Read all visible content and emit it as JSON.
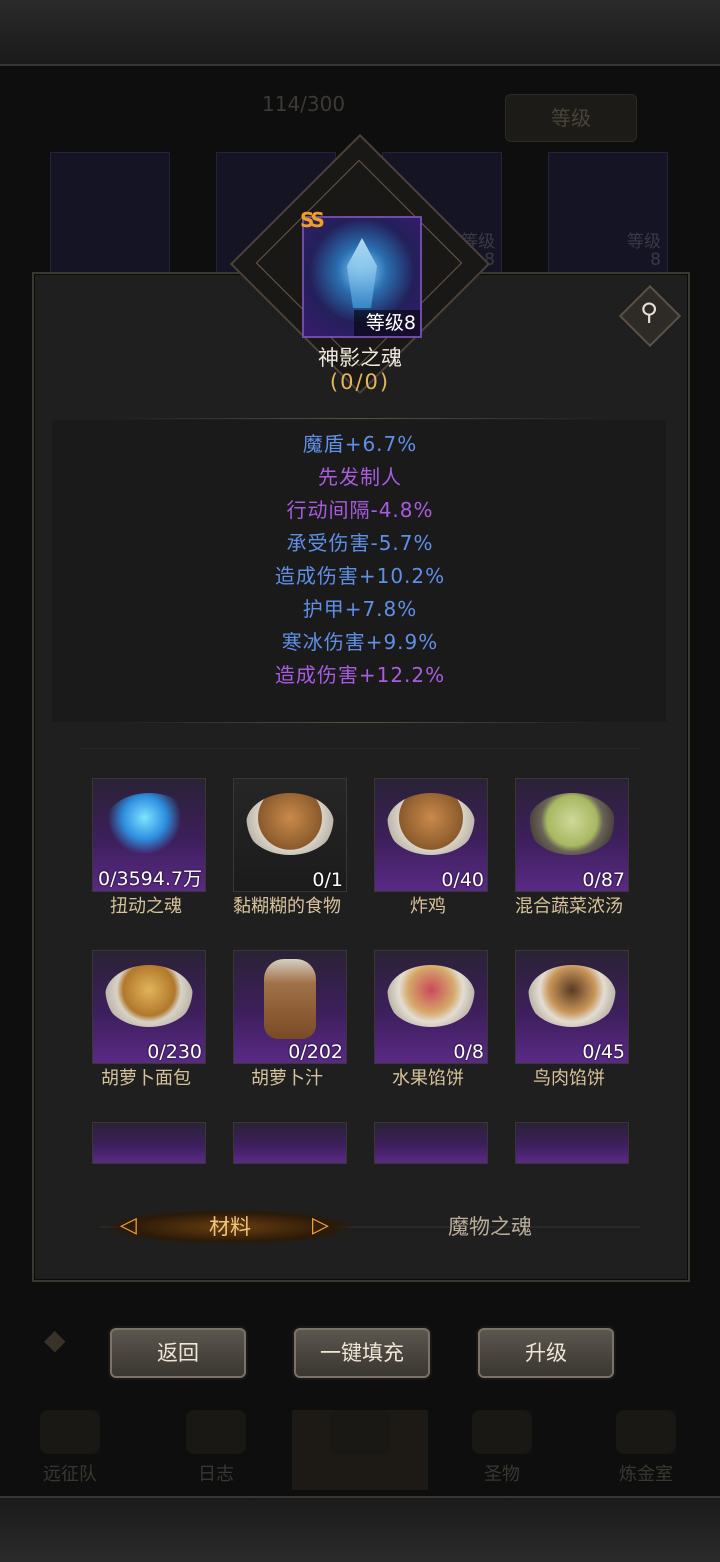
{
  "background": {
    "count": "114/300",
    "level_button": "等级",
    "card_level_label": "等级",
    "card_level_value": "8",
    "nav": [
      "远征队",
      "日志",
      "",
      "圣物",
      "炼金室"
    ]
  },
  "panel": {
    "badge": "SS",
    "level": "等级8",
    "name": "神影之魂",
    "progress": "(0/0)",
    "stats": [
      {
        "text": "魔盾+6.7%",
        "color": "#5f8fe6"
      },
      {
        "text": "先发制人",
        "color": "#a85ce0"
      },
      {
        "text": "行动间隔-4.8%",
        "color": "#a85ce0"
      },
      {
        "text": "承受伤害-5.7%",
        "color": "#5f8fe6"
      },
      {
        "text": "造成伤害+10.2%",
        "color": "#5f8fe6"
      },
      {
        "text": "护甲+7.8%",
        "color": "#5f8fe6"
      },
      {
        "text": "寒冰伤害+9.9%",
        "color": "#5f8fe6"
      },
      {
        "text": "造成伤害+12.2%",
        "color": "#a85ce0"
      }
    ],
    "items": [
      {
        "count": "0/3594.7万",
        "label": "扭动之魂",
        "rarity": "purple"
      },
      {
        "count": "0/1",
        "label": "黏糊糊的食物",
        "rarity": "grey"
      },
      {
        "count": "0/40",
        "label": "炸鸡",
        "rarity": "purple"
      },
      {
        "count": "0/87",
        "label": "混合蔬菜浓汤",
        "rarity": "purple"
      },
      {
        "count": "0/230",
        "label": "胡萝卜面包",
        "rarity": "purple"
      },
      {
        "count": "0/202",
        "label": "胡萝卜汁",
        "rarity": "purple"
      },
      {
        "count": "0/8",
        "label": "水果馅饼",
        "rarity": "purple"
      },
      {
        "count": "0/45",
        "label": "鸟肉馅饼",
        "rarity": "purple"
      }
    ],
    "tabs": {
      "active": "材料",
      "inactive": "魔物之魂"
    }
  },
  "buttons": {
    "back": "返回",
    "fill": "一键填充",
    "upgrade": "升级"
  },
  "icons": [
    "search-icon",
    "lock-icon",
    "ss-grade-icon"
  ]
}
